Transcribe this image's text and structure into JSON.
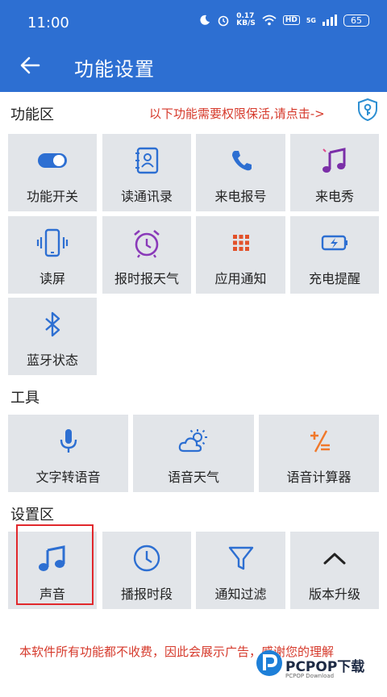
{
  "status_bar": {
    "time": "11:00",
    "net_speed": "0.17",
    "net_unit": "KB/S",
    "hd": "HD",
    "signal": "5G",
    "battery": "65"
  },
  "app_bar": {
    "title": "功能设置"
  },
  "sections": {
    "features": {
      "title": "功能区",
      "permission_hint": "以下功能需要权限保活,请点击->",
      "items": [
        {
          "label": "功能开关",
          "icon": "toggle-icon",
          "color": "#2d6fd2"
        },
        {
          "label": "读通讯录",
          "icon": "contacts-book-icon",
          "color": "#2d6fd2"
        },
        {
          "label": "来电报号",
          "icon": "phone-icon",
          "color": "#2d6fd2"
        },
        {
          "label": "来电秀",
          "icon": "music-note-icon",
          "color": "#7b2fa8"
        },
        {
          "label": "读屏",
          "icon": "phone-vibrate-icon",
          "color": "#2d6fd2"
        },
        {
          "label": "报时报天气",
          "icon": "alarm-clock-icon",
          "color": "#8a3ab9"
        },
        {
          "label": "应用通知",
          "icon": "grid-dots-icon",
          "color": "#e2512a"
        },
        {
          "label": "充电提醒",
          "icon": "battery-charging-icon",
          "color": "#2d6fd2"
        },
        {
          "label": "蓝牙状态",
          "icon": "bluetooth-icon",
          "color": "#2d6fd2"
        }
      ]
    },
    "tools": {
      "title": "工具",
      "items": [
        {
          "label": "文字转语音",
          "icon": "microphone-icon",
          "color": "#2d6fd2"
        },
        {
          "label": "语音天气",
          "icon": "weather-icon",
          "color": "#2d6fd2"
        },
        {
          "label": "语音计算器",
          "icon": "calculator-icon",
          "color": "#f0782a"
        }
      ]
    },
    "settings": {
      "title": "设置区",
      "items": [
        {
          "label": "声音",
          "icon": "music-icon",
          "color": "#2d6fd2"
        },
        {
          "label": "播报时段",
          "icon": "clock-icon",
          "color": "#2d6fd2"
        },
        {
          "label": "通知过滤",
          "icon": "filter-icon",
          "color": "#2d6fd2"
        },
        {
          "label": "版本升级",
          "icon": "chevron-up-icon",
          "color": "#222222"
        }
      ]
    }
  },
  "footer": {
    "notice": "本软件所有功能都不收费，因此会展示广告，感谢您的理解"
  },
  "watermark": {
    "brand": "PCPOP下载",
    "sub": "PCPOP Download"
  }
}
